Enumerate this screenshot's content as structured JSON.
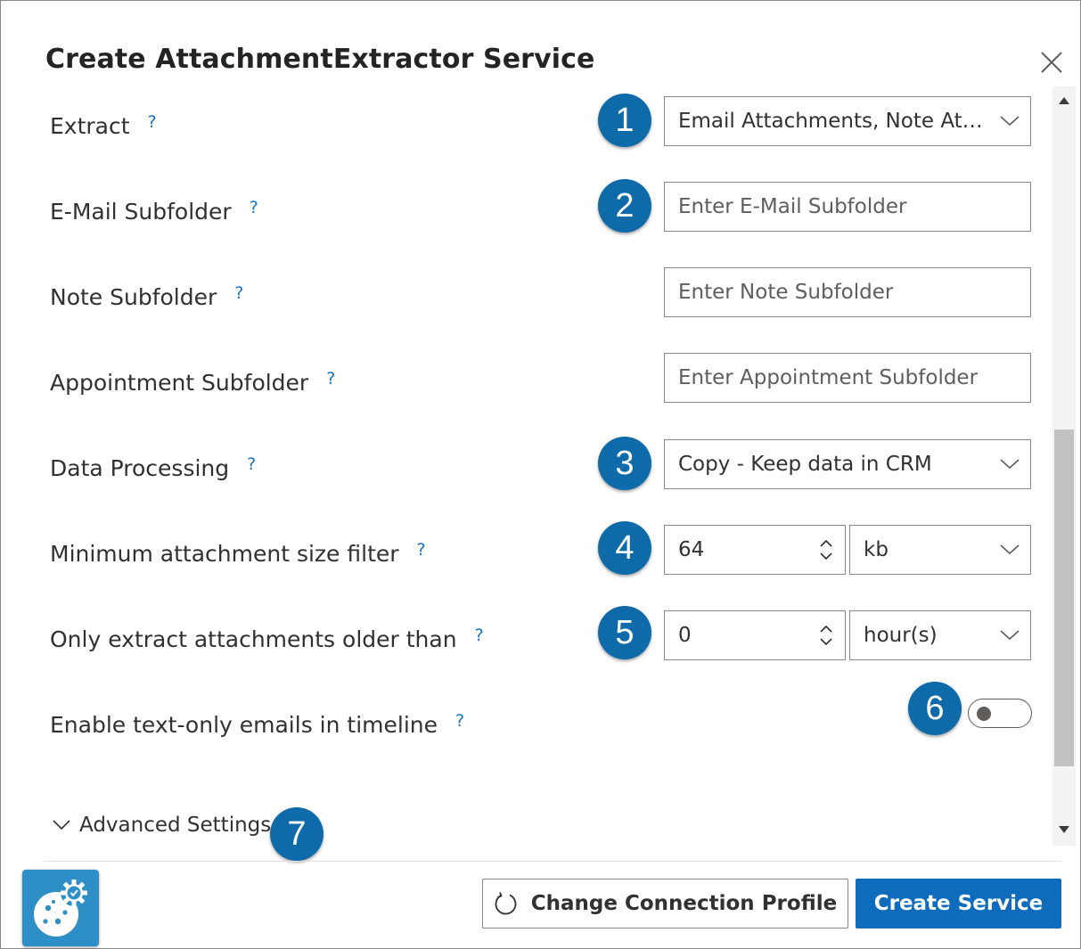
{
  "dialog": {
    "title": "Create AttachmentExtractor Service",
    "close_icon": "close-icon"
  },
  "help_symbol": "?",
  "form": {
    "extract": {
      "label": "Extract",
      "value": "Email Attachments, Note Atta...",
      "badge": "1"
    },
    "email_subfolder": {
      "label": "E-Mail Subfolder",
      "placeholder": "Enter E-Mail Subfolder",
      "badge": "2"
    },
    "note_subfolder": {
      "label": "Note Subfolder",
      "placeholder": "Enter Note Subfolder"
    },
    "appointment_subfolder": {
      "label": "Appointment Subfolder",
      "placeholder": "Enter Appointment Subfolder"
    },
    "data_processing": {
      "label": "Data Processing",
      "value": "Copy - Keep data in CRM",
      "badge": "3"
    },
    "min_size": {
      "label": "Minimum attachment size filter",
      "value": "64",
      "unit": "kb",
      "badge": "4"
    },
    "older_than": {
      "label": "Only extract attachments older than",
      "value": "0",
      "unit": "hour(s)",
      "badge": "5"
    },
    "text_only": {
      "label": "Enable text-only emails in timeline",
      "enabled": false,
      "badge": "6"
    }
  },
  "advanced": {
    "label": "Advanced Settings",
    "badge": "7"
  },
  "footer": {
    "change_profile_label": "Change Connection Profile",
    "create_label": "Create Service"
  },
  "colors": {
    "badge": "#0e6aa8",
    "primary": "#0f6cbd",
    "help": "#1a73c8",
    "logo": "#2e8fc6"
  }
}
